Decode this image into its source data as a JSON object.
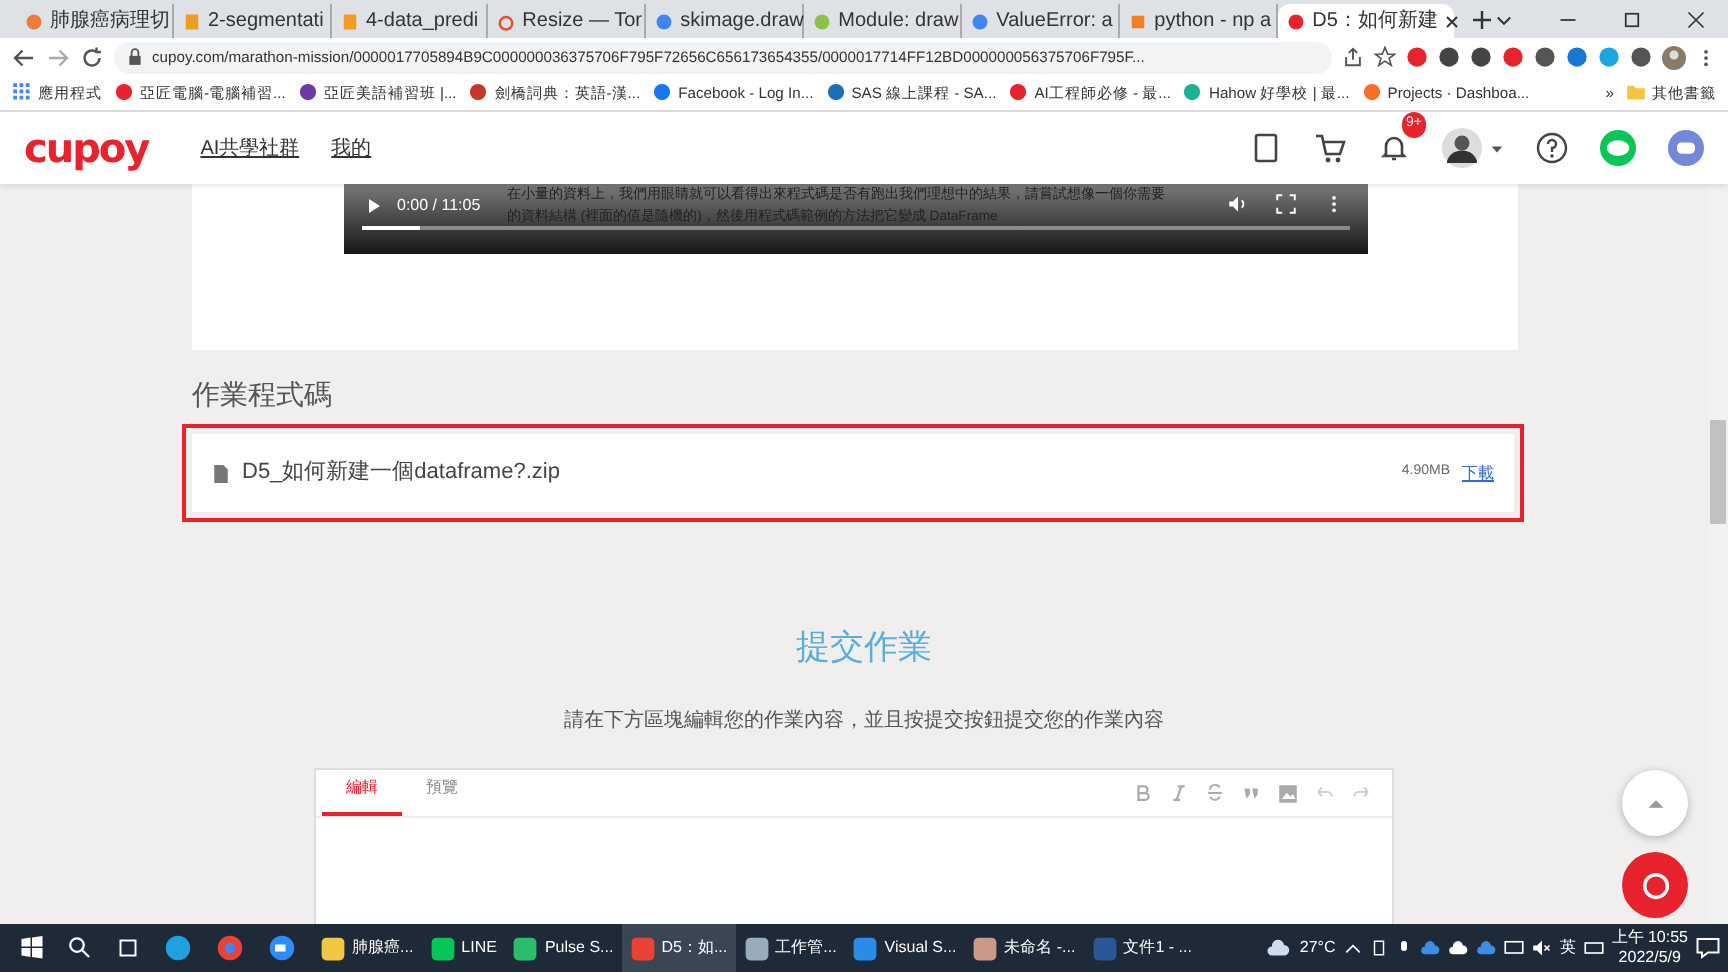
{
  "browser": {
    "tabs": [
      {
        "title": "肺腺癌病理切",
        "selected": false
      },
      {
        "title": "2-segmentati",
        "selected": false
      },
      {
        "title": "4-data_predi",
        "selected": false
      },
      {
        "title": "Resize — Tor",
        "selected": false
      },
      {
        "title": "skimage.draw",
        "selected": false
      },
      {
        "title": "Module: draw",
        "selected": false
      },
      {
        "title": "ValueError: a",
        "selected": false
      },
      {
        "title": "python - np a",
        "selected": false
      },
      {
        "title": "D5：如何新建",
        "selected": true
      }
    ],
    "address": "cupoy.com/marathon-mission/0000017705894B9C000000036375706F795F72656C656173654355/0000017714FF12BD000000056375706F795F...",
    "bookmarks": [
      "應用程式",
      "亞匠電腦-電腦補習...",
      "亞匠美語補習班 |...",
      "劍橋詞典：英語-漢...",
      "Facebook - Log In...",
      "SAS 線上課程 - SA...",
      "AI工程師必修 - 最...",
      "Hahow 好學校 | 最...",
      "Projects · Dashboa..."
    ],
    "more": "»",
    "other_bookmarks": "其他書籤"
  },
  "site_nav": {
    "logo": "cupoy",
    "links": [
      "AI共學社群",
      "我的"
    ],
    "notification_badge": "9+"
  },
  "video": {
    "caption_lines": [
      "在小量的資料上，我們用眼睛就可以看得出來程式碼是否有跑出我們理想中的結果，請嘗試想像一個你需要",
      "的資料結構 (裡面的值是隨機的)，然後用程式碼範例的方法把它變成 DataFrame"
    ],
    "time": "0:00 / 11:05",
    "level": 0.06
  },
  "homework_code": {
    "title": "作業程式碼",
    "file": {
      "name": "D5_如何新建一個dataframe?.zip",
      "size": "4.90MB",
      "download": "下載"
    }
  },
  "submit": {
    "title": "提交作業",
    "instruction": "請在下方區塊編輯您的作業內容，並且按提交按鈕提交您的作業內容",
    "editor_tabs": [
      {
        "label": "編輯",
        "selected": true
      },
      {
        "label": "預覽",
        "selected": false
      }
    ]
  },
  "taskbar": {
    "apps": [
      {
        "label": "肺腺癌...",
        "selected": false
      },
      {
        "label": "LINE",
        "selected": false
      },
      {
        "label": "Pulse S...",
        "selected": false
      },
      {
        "label": "D5：如...",
        "selected": true
      },
      {
        "label": "工作管...",
        "selected": false
      },
      {
        "label": "Visual S...",
        "selected": false
      },
      {
        "label": "未命名 -...",
        "selected": false
      },
      {
        "label": "文件1 - ...",
        "selected": false
      }
    ],
    "weather": "27°C",
    "ime": "英",
    "time": "上午 10:55",
    "date": "2022/5/9"
  }
}
